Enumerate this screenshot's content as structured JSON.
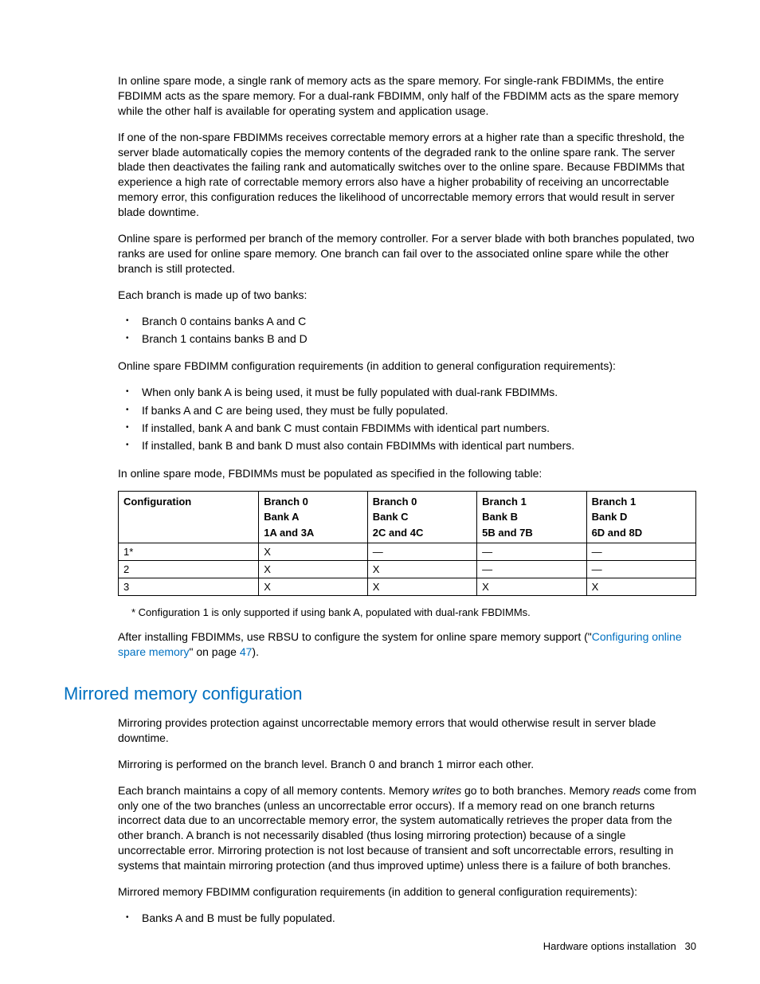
{
  "paragraphs": {
    "p1": "In online spare mode, a single rank of memory acts as the spare memory. For single-rank FBDIMMs, the entire FBDIMM acts as the spare memory. For a dual-rank FBDIMM, only half of the FBDIMM acts as the spare memory while the other half is available for operating system and application usage.",
    "p2": "If one of the non-spare FBDIMMs receives correctable memory errors at a higher rate than a specific threshold, the server blade automatically copies the memory contents of the degraded rank to the online spare rank. The server blade then deactivates the failing rank and automatically switches over to the online spare. Because FBDIMMs that experience a high rate of correctable memory errors also have a higher probability of receiving an uncorrectable memory error, this configuration reduces the likelihood of uncorrectable memory errors that would result in server blade downtime.",
    "p3": "Online spare is performed per branch of the memory controller. For a server blade with both branches populated, two ranks are used for online spare memory. One branch can fail over to the associated online spare while the other branch is still protected.",
    "p4": "Each branch is made up of two banks:",
    "p5": "Online spare FBDIMM configuration requirements (in addition to general configuration requirements):",
    "p6": "In online spare mode, FBDIMMs must be populated as specified in the following table:",
    "footnote": "* Configuration 1 is only supported if using bank A, populated with dual-rank FBDIMMs.",
    "p7a": "After installing FBDIMMs, use RBSU to configure the system for online spare memory support (\"",
    "p7link": "Configuring online spare memory",
    "p7b": "\" on page ",
    "p7page": "47",
    "p7c": ").",
    "h2": "Mirrored memory configuration",
    "m1": "Mirroring provides protection against uncorrectable memory errors that would otherwise result in server blade downtime.",
    "m2": "Mirroring is performed on the branch level. Branch 0 and branch 1 mirror each other.",
    "m3a": "Each branch maintains a copy of all memory contents. Memory ",
    "m3i1": "writes",
    "m3b": " go to both branches. Memory ",
    "m3i2": "reads",
    "m3c": " come from only one of the two branches (unless an uncorrectable error occurs). If a memory read on one branch returns incorrect data due to an uncorrectable memory error, the system automatically retrieves the proper data from the other branch. A branch is not necessarily disabled (thus losing mirroring protection) because of a single uncorrectable error. Mirroring protection is not lost because of transient and soft uncorrectable errors, resulting in systems that maintain mirroring protection (and thus improved uptime) unless there is a failure of both branches.",
    "m4": "Mirrored memory FBDIMM configuration requirements (in addition to general configuration requirements):"
  },
  "bullets1": [
    "Branch 0 contains banks A and C",
    "Branch 1 contains banks B and D"
  ],
  "bullets2": [
    "When only bank A is being used, it must be fully populated with dual-rank FBDIMMs.",
    "If banks A and C are being used, they must be fully populated.",
    "If installed, bank A and bank C must contain FBDIMMs with identical part numbers.",
    "If installed, bank B and bank D must also contain FBDIMMs with identical part numbers."
  ],
  "bullets3": [
    "Banks A and B must be fully populated."
  ],
  "table": {
    "headers": [
      {
        "l1": "Configuration",
        "l2": "",
        "l3": ""
      },
      {
        "l1": "Branch 0",
        "l2": "Bank A",
        "l3": "1A and 3A"
      },
      {
        "l1": "Branch 0",
        "l2": "Bank C",
        "l3": "2C and 4C"
      },
      {
        "l1": "Branch 1",
        "l2": "Bank B",
        "l3": "5B and 7B"
      },
      {
        "l1": "Branch 1",
        "l2": "Bank D",
        "l3": "6D and 8D"
      }
    ],
    "rows": [
      [
        "1*",
        "X",
        "—",
        "—",
        "—"
      ],
      [
        "2",
        "X",
        "X",
        "—",
        "—"
      ],
      [
        "3",
        "X",
        "X",
        "X",
        "X"
      ]
    ]
  },
  "footer": {
    "text": "Hardware options installation",
    "page": "30"
  }
}
